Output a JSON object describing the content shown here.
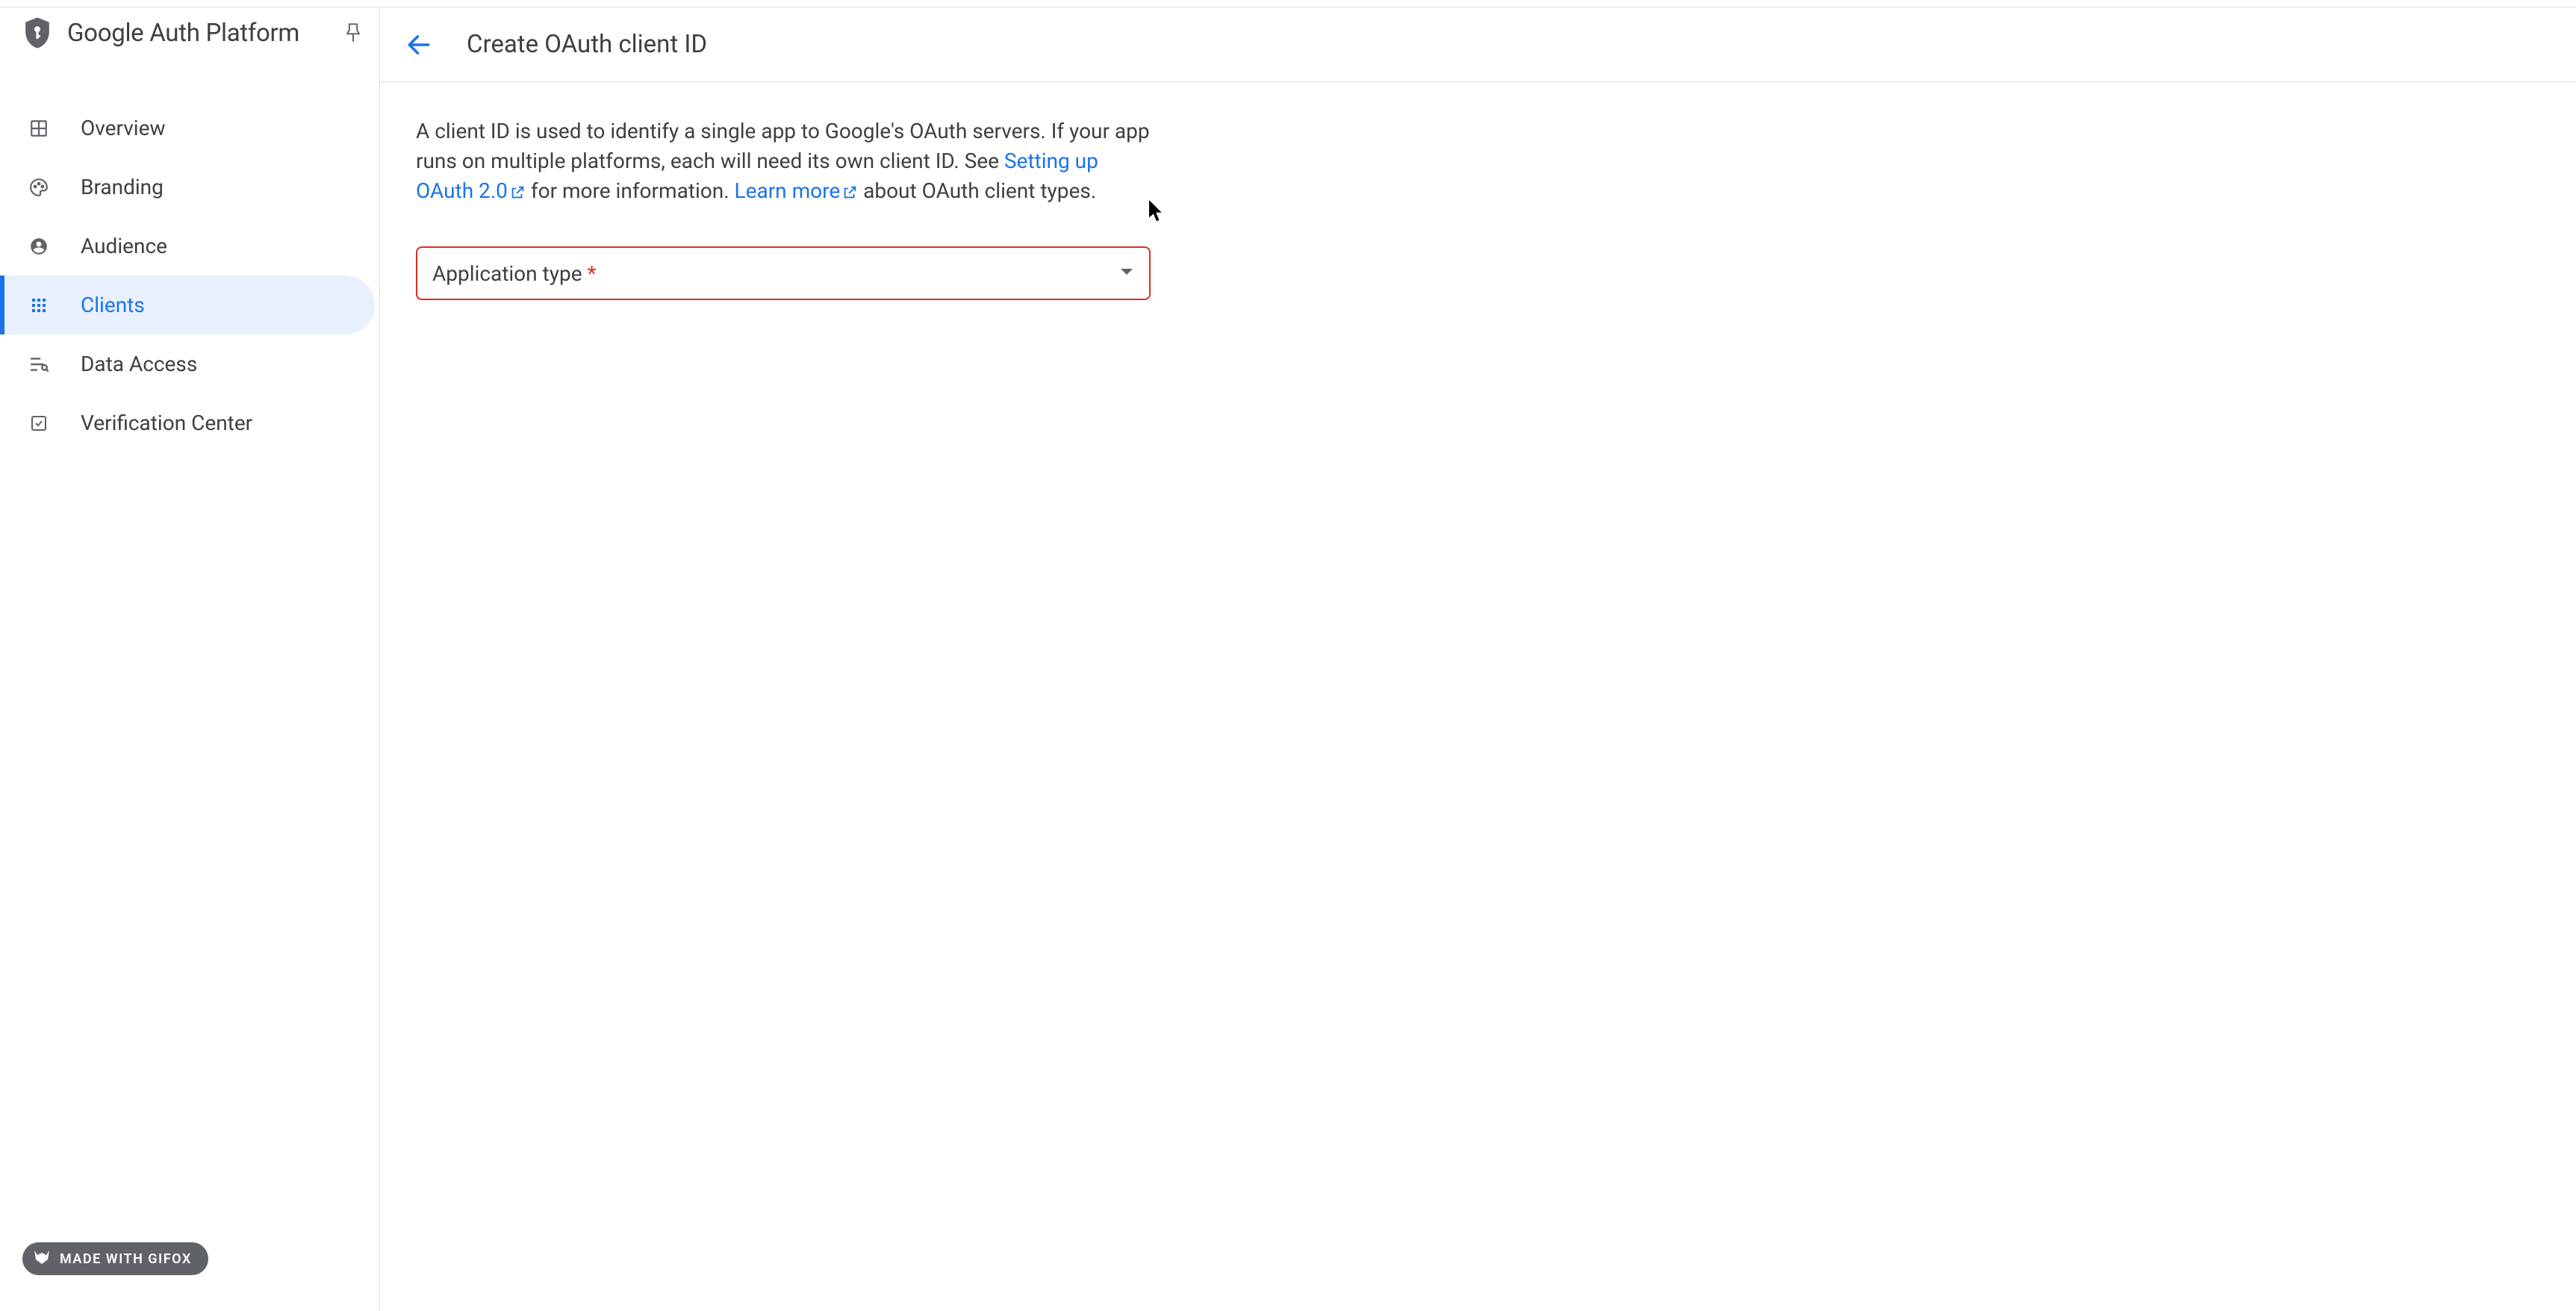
{
  "sidebar": {
    "title": "Google Auth Platform",
    "items": [
      {
        "label": "Overview",
        "icon": "dashboard"
      },
      {
        "label": "Branding",
        "icon": "palette"
      },
      {
        "label": "Audience",
        "icon": "account"
      },
      {
        "label": "Clients",
        "icon": "apps"
      },
      {
        "label": "Data Access",
        "icon": "filter"
      },
      {
        "label": "Verification Center",
        "icon": "check-square"
      }
    ]
  },
  "header": {
    "page_title": "Create OAuth client ID"
  },
  "content": {
    "desc_part1": "A client ID is used to identify a single app to Google's OAuth servers. If your app runs on multiple platforms, each will need its own client ID. See ",
    "link1": "Setting up OAuth 2.0",
    "desc_part2": " for more information. ",
    "link2": "Learn more",
    "desc_part3": " about OAuth client types."
  },
  "form": {
    "app_type_label": "Application type",
    "required_mark": " *"
  },
  "badge": {
    "text": "MADE WITH GIFOX"
  },
  "colors": {
    "primary": "#1a73e8",
    "error": "#d93025",
    "text": "#3c4043",
    "icon": "#5f6368",
    "active_bg": "#e8f0fe"
  }
}
